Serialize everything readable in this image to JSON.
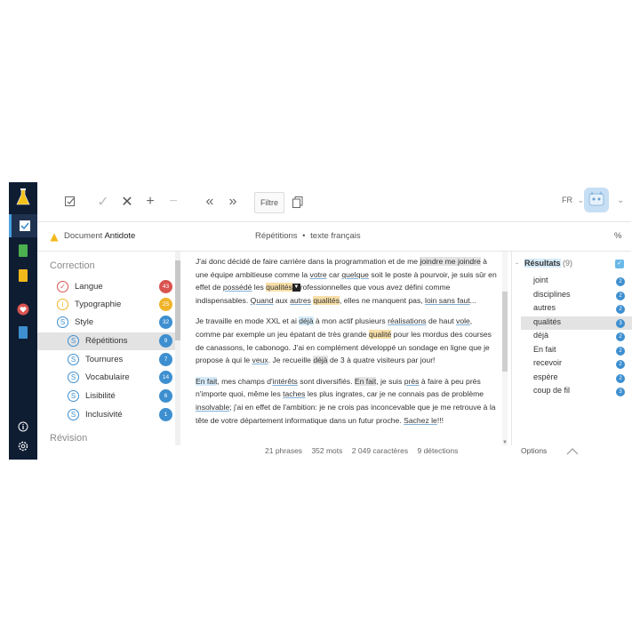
{
  "toolbar": {
    "filter_label": "Filtre",
    "language": "FR"
  },
  "docbar": {
    "doc_prefix": "Document",
    "doc_name": "Antidote",
    "context": "Répétitions",
    "separator": "•",
    "context2": "texte français",
    "percent": "%"
  },
  "sidebar": {
    "section_correction": "Correction",
    "section_revision": "Révision",
    "items": [
      {
        "label": "Langue",
        "count": "43",
        "color": "#d9534f",
        "icon": "check-circle-icon"
      },
      {
        "label": "Typographie",
        "count": "25",
        "color": "#f0b429",
        "icon": "info-circle-icon"
      },
      {
        "label": "Style",
        "count": "32",
        "color": "#3d8fd0",
        "icon": "style-s-icon"
      },
      {
        "label": "Répétitions",
        "count": "9",
        "color": "#3d8fd0",
        "icon": "style-s-icon"
      },
      {
        "label": "Tournures",
        "count": "7",
        "color": "#3d8fd0",
        "icon": "style-s-icon"
      },
      {
        "label": "Vocabulaire",
        "count": "14",
        "color": "#3d8fd0",
        "icon": "style-s-icon"
      },
      {
        "label": "Lisibilité",
        "count": "6",
        "color": "#3d8fd0",
        "icon": "style-s-icon"
      },
      {
        "label": "Inclusivité",
        "count": "1",
        "color": "#3d8fd0",
        "icon": "style-s-icon"
      }
    ]
  },
  "editor": {
    "p1": {
      "a": "J'ai donc décidé de faire carrière dans la programmation et de me ",
      "b": "joindre me joindre",
      "c": " à une équipe ambitieuse comme la ",
      "d": "votre",
      "e": " car ",
      "f": "quelque",
      "g": " soit le poste à pourvoir, je suis sûr en effet de ",
      "h": "possédé",
      "i": " les ",
      "j": "qualités",
      "k": "rofessionnelles que vous avez défini comme indispensables. ",
      "l": "Quand",
      "m": " aux ",
      "n": "autres",
      "o": " ",
      "p": "qualités",
      "q": ", elles ne manquent pas, ",
      "r": "loin sans faut",
      "s": "..."
    },
    "p2": {
      "a": "Je travaille en mode XXL et ai ",
      "b": "déjà",
      "c": " à mon actif plusieurs ",
      "d": "réalisations",
      "e": " de haut ",
      "f": "vole",
      "g": ", comme par exemple un jeu épatant de très grande ",
      "h": "qualité",
      "i": " pour les mordus des courses de canassons, le cabonogo. J'ai en complément développé un sondage en ligne que je propose à qui le ",
      "j": "veux",
      "k": ". Je recueille ",
      "l": "déjà",
      "m": " de 3 à quatre visiteurs par jour!"
    },
    "p3": {
      "a": "En fait",
      "b": ", mes champs d'",
      "c": "intérêts",
      "d": " sont diversifiés. ",
      "e": "En fait",
      "f": ", je suis ",
      "g": "près",
      "h": " à faire à peu près n'importe quoi, même  les ",
      "i": "taches",
      "j": " les plus ingrates, car je ne connais pas de problème ",
      "k": "insolvable",
      "l": "; j'ai en effet de l'ambition: je ne crois pas inconcevable que je me retrouve à la tête de votre département informatique  dans un futur proche. ",
      "m": "Sachez le",
      "n": "!!!"
    }
  },
  "status": {
    "phrases": "21 phrases",
    "mots": "352 mots",
    "caracteres": "2 049 caractères",
    "detections": "9 détections"
  },
  "results": {
    "header": "Résultats",
    "count": "(9)",
    "items": [
      {
        "label": "joint",
        "count": "2"
      },
      {
        "label": "disciplines",
        "count": "2"
      },
      {
        "label": "autres",
        "count": "2"
      },
      {
        "label": "qualités",
        "count": "3"
      },
      {
        "label": "déjà",
        "count": "2"
      },
      {
        "label": "En fait",
        "count": "2"
      },
      {
        "label": "recevoir",
        "count": "2"
      },
      {
        "label": "espère",
        "count": "2"
      },
      {
        "label": "coup de fil",
        "count": "3"
      }
    ],
    "options_label": "Options"
  }
}
